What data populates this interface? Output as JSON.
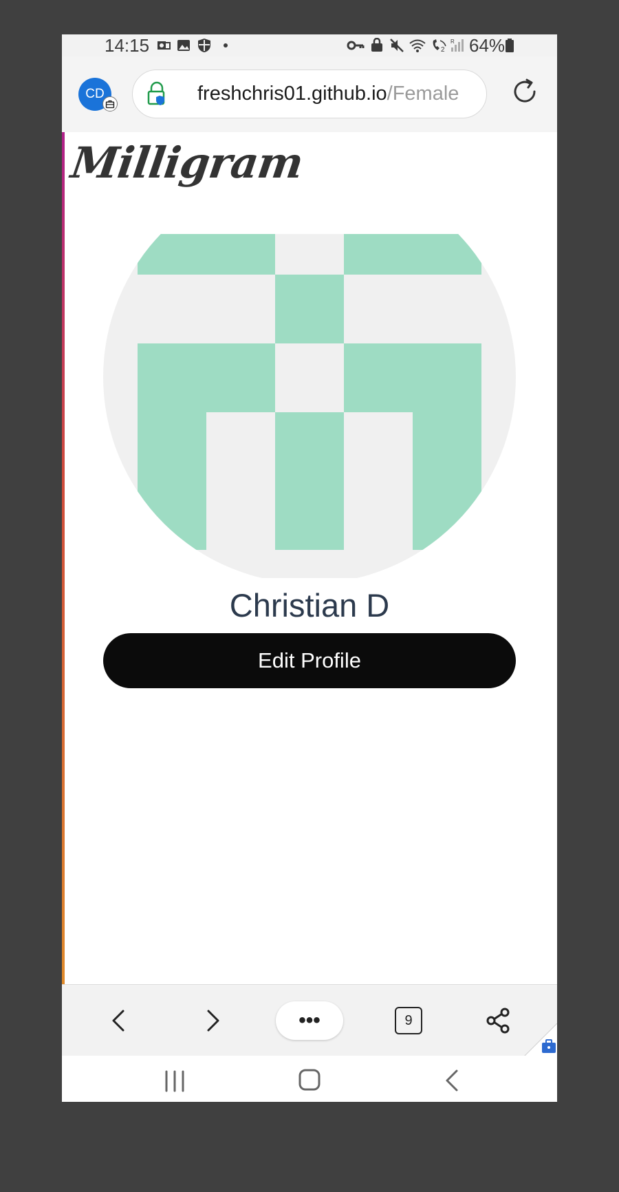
{
  "status_bar": {
    "time": "14:15",
    "battery": "64%",
    "icons": [
      "outlook-icon",
      "gallery-icon",
      "shield-icon",
      "dot-icon",
      "key-icon",
      "lock-icon",
      "mute-icon",
      "wifi-icon",
      "volte-icon",
      "signal-icon",
      "battery-icon"
    ]
  },
  "browser": {
    "profile_initials": "CD",
    "url_domain": "freshchris01.github.io",
    "url_path": "/Female",
    "tab_count": "9",
    "menu_label": "•••"
  },
  "page": {
    "logo": "Milligram",
    "user_name": "Christian D",
    "edit_button_label": "Edit Profile"
  },
  "colors": {
    "avatar_bg": "#f0f0f0",
    "avatar_pattern": "#9edcc3",
    "button_bg": "#0b0b0b",
    "name_color": "#2c3a4d",
    "profile_badge": "#1a73d9"
  }
}
